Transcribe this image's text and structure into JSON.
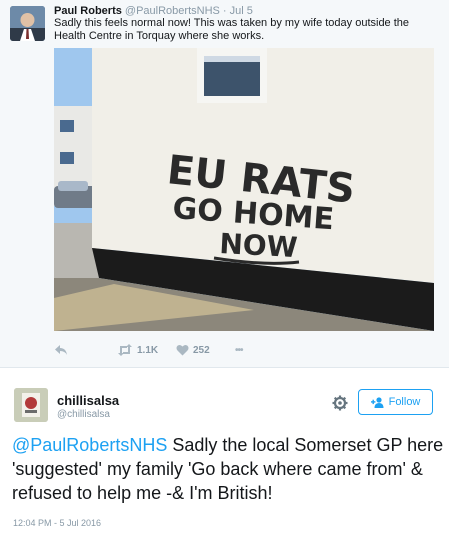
{
  "quoted_tweet": {
    "name": "Paul Roberts",
    "handle": "@PaulRobertsNHS",
    "separator": "·",
    "date": "Jul 5",
    "text": "Sadly this feels normal now! This was taken by my wife today outside the Health Centre in Torquay where she works.",
    "image": {
      "graffiti_line1": "EU RATS",
      "graffiti_line2": "GO HOME",
      "graffiti_line3": "NOW"
    },
    "retweets": "1.1K",
    "likes": "252",
    "more": "•••"
  },
  "main_tweet": {
    "name": "chillisalsa",
    "handle": "@chillisalsa",
    "follow_label": "Follow",
    "mention": "@PaulRobertsNHS",
    "text": " Sadly the local Somerset GP here 'suggested' my family 'Go back where came from' & refused to help me -& I'm British!",
    "timestamp": "12:04 PM - 5 Jul 2016"
  },
  "colors": {
    "accent": "#1da1f2",
    "muted": "#8899a6",
    "quote_bg": "#f5f8fa"
  },
  "icons": [
    "reply-icon",
    "retweet-icon",
    "like-icon",
    "more-icon",
    "gear-icon",
    "follow-person-icon"
  ]
}
